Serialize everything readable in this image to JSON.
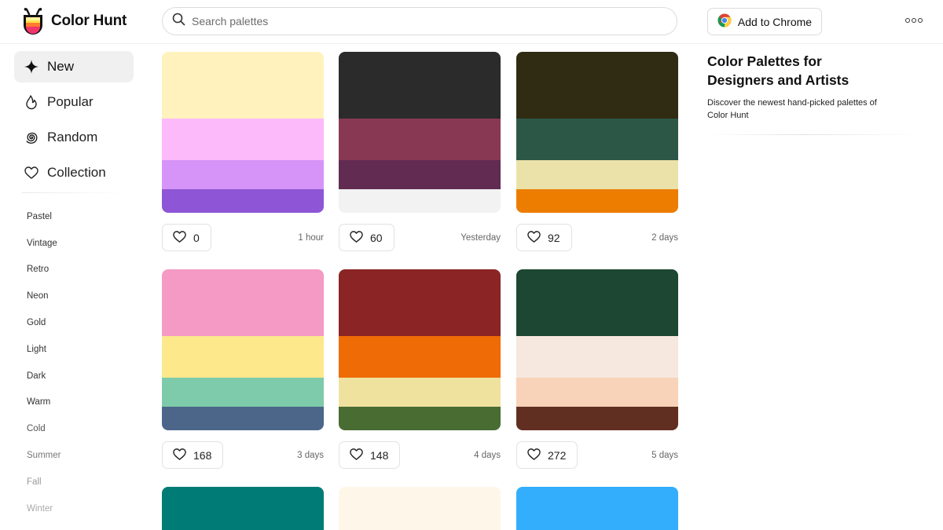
{
  "app": {
    "title": "Color Hunt"
  },
  "search": {
    "placeholder": "Search palettes",
    "value": ""
  },
  "header": {
    "chrome_label": "Add to Chrome"
  },
  "sidebar": {
    "nav": [
      {
        "label": "New",
        "icon": "sparkle-icon",
        "active": true
      },
      {
        "label": "Popular",
        "icon": "flame-icon",
        "active": false
      },
      {
        "label": "Random",
        "icon": "spiral-icon",
        "active": false
      },
      {
        "label": "Collection",
        "icon": "heart-icon",
        "active": false
      }
    ],
    "tags": [
      "Pastel",
      "Vintage",
      "Retro",
      "Neon",
      "Gold",
      "Light",
      "Dark",
      "Warm",
      "Cold",
      "Summer",
      "Fall",
      "Winter"
    ]
  },
  "palettes": [
    {
      "colors": [
        "#fff2bd",
        "#fdbafb",
        "#d694f8",
        "#8e56d6"
      ],
      "likes": "0",
      "time": "1 hour"
    },
    {
      "colors": [
        "#2b2b2b",
        "#893853",
        "#622b51",
        "#f2f2f2"
      ],
      "likes": "60",
      "time": "Yesterday"
    },
    {
      "colors": [
        "#302b13",
        "#2c5747",
        "#ebe2a9",
        "#ec7d00"
      ],
      "likes": "92",
      "time": "2 days"
    },
    {
      "colors": [
        "#f49ac5",
        "#fde88b",
        "#7ecbab",
        "#4b6689"
      ],
      "likes": "168",
      "time": "3 days"
    },
    {
      "colors": [
        "#8b2425",
        "#ee6b05",
        "#efe29e",
        "#496c33"
      ],
      "likes": "148",
      "time": "4 days"
    },
    {
      "colors": [
        "#1d4732",
        "#f6e8df",
        "#f8d2b9",
        "#612f22"
      ],
      "likes": "272",
      "time": "5 days"
    },
    {
      "colors": [
        "#007b76"
      ],
      "likes": "",
      "time": ""
    },
    {
      "colors": [
        "#fef6e9"
      ],
      "likes": "",
      "time": ""
    },
    {
      "colors": [
        "#33aefc"
      ],
      "likes": "",
      "time": ""
    }
  ],
  "right_panel": {
    "title": "Color Palettes for Designers and Artists",
    "description": "Discover the newest hand-picked palettes of Color Hunt"
  }
}
